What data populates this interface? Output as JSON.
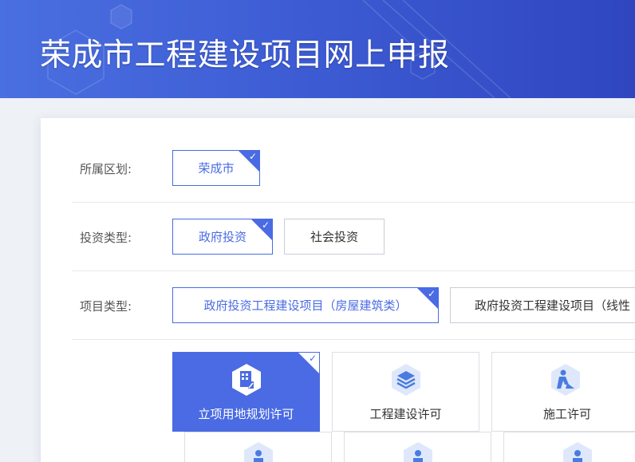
{
  "header": {
    "title": "荣成市工程建设项目网上申报"
  },
  "district": {
    "label": "所属区划:",
    "options": [
      {
        "label": "荣成市",
        "selected": true
      }
    ]
  },
  "investment_type": {
    "label": "投资类型:",
    "options": [
      {
        "label": "政府投资",
        "selected": true
      },
      {
        "label": "社会投资",
        "selected": false
      }
    ]
  },
  "project_type": {
    "label": "项目类型:",
    "options": [
      {
        "label": "政府投资工程建设项目（房屋建筑类）",
        "selected": true
      },
      {
        "label": "政府投资工程建设项目（线性",
        "selected": false
      }
    ]
  },
  "permits": [
    {
      "label": "立项用地规划许可",
      "icon": "planning-doc-icon",
      "selected": true
    },
    {
      "label": "工程建设许可",
      "icon": "layers-icon",
      "selected": false
    },
    {
      "label": "施工许可",
      "icon": "construction-worker-icon",
      "selected": false
    }
  ],
  "permits_row2": [
    {
      "icon": "person-stamp-icon"
    },
    {
      "icon": "person-stamp-icon"
    },
    {
      "icon": "person-stamp-icon"
    }
  ],
  "colors": {
    "accent": "#4a6be3",
    "banner": "#3f5fd6",
    "border": "#c9cdd6"
  }
}
